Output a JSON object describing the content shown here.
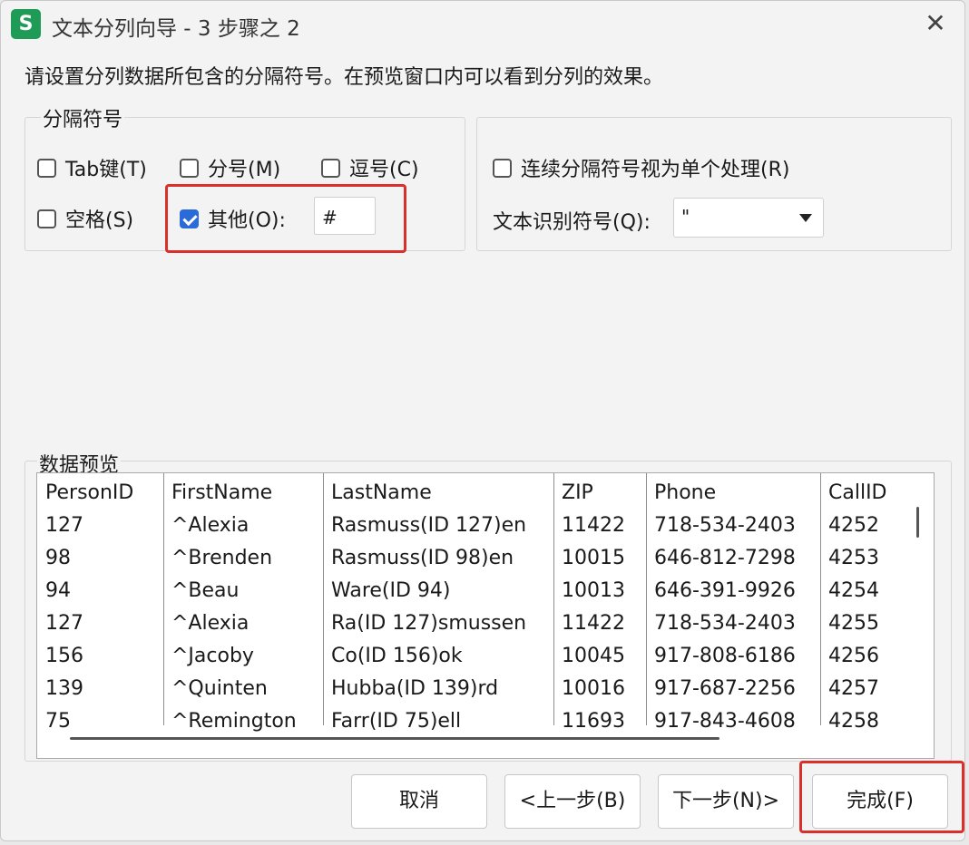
{
  "window": {
    "app_icon_glyph": "S",
    "title": "文本分列向导 - 3 步骤之 2",
    "close_glyph": "✕"
  },
  "instruction": "请设置分列数据所包含的分隔符号。在预览窗口内可以看到分列的效果。",
  "delimiters": {
    "group_label": "分隔符号",
    "tab": {
      "label": "Tab键(T)",
      "checked": false
    },
    "semicolon": {
      "label": "分号(M)",
      "checked": false
    },
    "comma": {
      "label": "逗号(C)",
      "checked": false
    },
    "space": {
      "label": "空格(S)",
      "checked": false
    },
    "other": {
      "label": "其他(O):",
      "checked": true,
      "value": "#"
    }
  },
  "options": {
    "consecutive": {
      "label": "连续分隔符号视为单个处理(R)",
      "checked": false
    },
    "text_qualifier_label": "文本识别符号(Q):",
    "text_qualifier_value": "\""
  },
  "preview": {
    "label": "数据预览",
    "columns": [
      "PersonID",
      "FirstName",
      "LastName",
      "ZIP",
      "Phone",
      "CallID"
    ],
    "rows": [
      [
        "127",
        "^Alexia",
        "Rasmuss(ID 127)en",
        "11422",
        "718-534-2403",
        "4252"
      ],
      [
        "98",
        "^Brenden",
        "Rasmuss(ID 98)en",
        "10015",
        "646-812-7298",
        "4253"
      ],
      [
        "94",
        "^Beau",
        "Ware(ID 94)",
        "10013",
        "646-391-9926",
        "4254"
      ],
      [
        "127",
        "^Alexia",
        "Ra(ID 127)smussen",
        "11422",
        "718-534-2403",
        "4255"
      ],
      [
        "156",
        "^Jacoby",
        "Co(ID 156)ok",
        "10045",
        "917-808-6186",
        "4256"
      ],
      [
        "139",
        "^Quinten",
        "Hubba(ID 139)rd",
        "10016",
        "917-687-2256",
        "4257"
      ],
      [
        "75",
        "^Remington",
        "Farr(ID 75)ell",
        "11693",
        "917-843-4608",
        "4258"
      ]
    ]
  },
  "buttons": {
    "cancel": "取消",
    "back": "<上一步(B)",
    "next": "下一步(N)>",
    "finish": "完成(F)"
  },
  "colors": {
    "accent": "#2a6bd9",
    "highlight": "#d9302b",
    "app_icon": "#1f9b58"
  }
}
